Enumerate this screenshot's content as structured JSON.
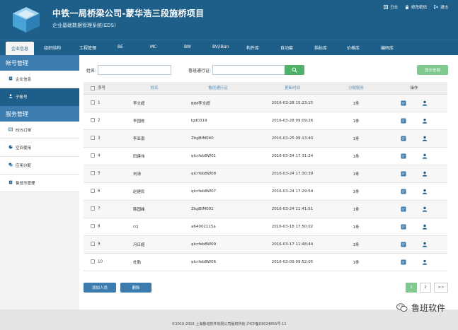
{
  "header": {
    "title": "中铁一局桥梁公司-蒙华浩三段施桥项目",
    "subtitle": "企业基础数据管理系统(EDS)",
    "links": [
      {
        "label": "日志",
        "icon": "log-icon"
      },
      {
        "label": "修改密码",
        "icon": "lock-icon"
      },
      {
        "label": "退出",
        "icon": "logout-icon"
      }
    ]
  },
  "nav": {
    "items": [
      "企业信息",
      "组织结构",
      "工程管理",
      "BE",
      "MC",
      "BW",
      "BV/iBan",
      "构件库",
      "自动套",
      "指标库",
      "价格库",
      "编码库"
    ]
  },
  "sidebar": {
    "section1": "帐号管理",
    "section1_items": [
      "企业信息",
      "子帐号"
    ],
    "section2": "服务管理",
    "section2_items": [
      "EDS订单",
      "空间使用",
      "应用分配",
      "鲁班币管理"
    ]
  },
  "search": {
    "name_label": "姓名:",
    "pass_label": "鲁班通行证:",
    "show_all": "显示全部"
  },
  "table": {
    "headers": [
      "序号",
      "姓名",
      "鲁班通行证",
      "更新时间",
      "分配服务",
      "操作"
    ],
    "rows": [
      {
        "idx": "1",
        "name": "李文超",
        "pass": "BIM李文超",
        "time": "2016-03-28 15:23:15",
        "service": "1条"
      },
      {
        "idx": "2",
        "name": "李国栋",
        "pass": "lgd0319",
        "time": "2016-03-28 09:09:26",
        "service": "1条"
      },
      {
        "idx": "3",
        "name": "李亚南",
        "pass": "ZtqjBIM040",
        "time": "2016-03-25 09:13:40",
        "service": "1条"
      },
      {
        "idx": "4",
        "name": "田建伟",
        "pass": "qlcrfebBW01",
        "time": "2016-03-24 17:31:24",
        "service": "1条"
      },
      {
        "idx": "5",
        "name": "刘涛",
        "pass": "qlcrfebBW08",
        "time": "2016-03-24 17:30:39",
        "service": "1条"
      },
      {
        "idx": "6",
        "name": "赵建民",
        "pass": "qlcrfebBW07",
        "time": "2016-03-24 17:29:54",
        "service": "1条"
      },
      {
        "idx": "7",
        "name": "韩国峰",
        "pass": "ZtqjBIM001",
        "time": "2016-03-24 11:41:51",
        "service": "1条"
      },
      {
        "idx": "8",
        "name": "ccj",
        "pass": "a64002115a",
        "time": "2016-03-18 17:50:02",
        "service": "1条"
      },
      {
        "idx": "9",
        "name": "冯日超",
        "pass": "qlcrfebBW09",
        "time": "2016-03-17 11:48:44",
        "service": "1条"
      },
      {
        "idx": "10",
        "name": "杜勤",
        "pass": "qlcrfebBW06",
        "time": "2016-03-09 09:52:05",
        "service": "1条"
      }
    ]
  },
  "actions": {
    "add": "添加人员",
    "delete": "删除"
  },
  "pager": {
    "pages": [
      "1",
      "2"
    ],
    "next": ">>"
  },
  "footer": {
    "text": "©2010-2016 上海鲁班软件有限公司版权所有 沪ICP备09024855号-11",
    "watermark": "鲁班软件"
  },
  "colors": {
    "header": "#1d5f88",
    "sidebar_header": "#3b7bae",
    "green": "#4fb268",
    "light_green": "#80c98f"
  }
}
